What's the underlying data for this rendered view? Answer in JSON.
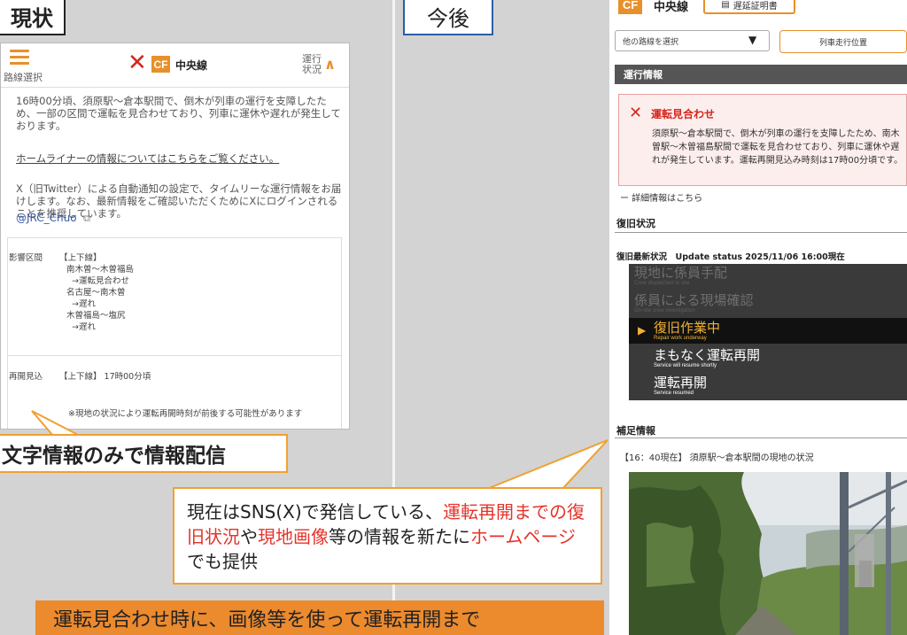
{
  "labels": {
    "current": "現状",
    "future": "今後"
  },
  "old_page": {
    "route_select": "路線選択",
    "line_name": "中央線",
    "logo": "CF",
    "status_label_1": "運行",
    "status_label_2": "状況",
    "notice": "16時00分頃、須原駅～倉本駅間で、倒木が列車の運行を支障したため、一部の区間で運転を見合わせており、列車に運休や遅れが発生しております。",
    "homeliner_link": "ホームライナーの情報についてはこちらをご覧ください。",
    "x_notice": "X（旧Twitter）による自動通知の設定で、タイムリーな運行情報をお届けします。なお、最新情報をご確認いただくためにXにログインされることを推奨しています。",
    "x_handle": "@JRC_Chuo",
    "affected_label": "影響区間",
    "affected_lines": [
      "【上下線】",
      "南木曽～木曽福島",
      "→運転見合わせ",
      "名古屋～南木曽",
      "→遅れ",
      "木曽福島～塩尻",
      "→遅れ"
    ],
    "resume_label": "再開見込",
    "resume_value": "【上下線】 17時00分頃",
    "note": "※現地の状況により運転再開時刻が前後する可能性があります"
  },
  "callouts": {
    "text_only": "文字情報のみで情報配信",
    "future_parts": [
      {
        "text": "現在はSNS(X)で発信している、",
        "red": false
      },
      {
        "text": "運転再開までの復旧状況",
        "red": true
      },
      {
        "text": "や",
        "red": false
      },
      {
        "text": "現地画像",
        "red": true
      },
      {
        "text": "等の情報を新たに",
        "red": false
      },
      {
        "text": "ホームページ",
        "red": true
      },
      {
        "text": "でも提供",
        "red": false
      }
    ],
    "bottom_banner": "運転見合わせ時に、画像等を使って運転再開まで"
  },
  "new_page": {
    "logo": "CF",
    "line_name": "中央線",
    "delay_cert": "遅延証明書",
    "route_dropdown": "他の路線を選択",
    "train_position": "列車走行位置",
    "op_info_header": "運行情報",
    "alert_title": "運転見合わせ",
    "alert_body": "須原駅～倉本駅間で、倒木が列車の運行を支障したため、南木曽駅～木曽福島駅間で運転を見合わせており、列車に運休や遅れが発生しています。運転再開見込み時刻は17時00分頃です。",
    "detail_link": "ー 詳細情報はこちら",
    "recovery_title": "復旧状況",
    "update_status": "復旧最新状況　Update status 2025/11/06 16:00現在",
    "steps": [
      {
        "jp": "現地に係員手配",
        "en": "Crew dispatched to site",
        "state": "dim"
      },
      {
        "jp": "係員による現場確認",
        "en": "On-site crew investigation",
        "state": "dim"
      },
      {
        "jp": "復旧作業中",
        "en": "Repair work underway",
        "state": "active"
      },
      {
        "jp": "まもなく運転再開",
        "en": "Service will resume shortly",
        "state": "on"
      },
      {
        "jp": "運転再開",
        "en": "Service resumed",
        "state": "on"
      }
    ],
    "supp_title": "補足情報",
    "supp_text": "【16：40現在】 須原駅～倉本駅間の現地の状況"
  },
  "colors": {
    "accent_orange": "#e8902a",
    "alert_red": "#d6261c",
    "highlight_red": "#e4332a",
    "banner_orange": "#ec8a2e",
    "active_step": "#f3b233"
  }
}
